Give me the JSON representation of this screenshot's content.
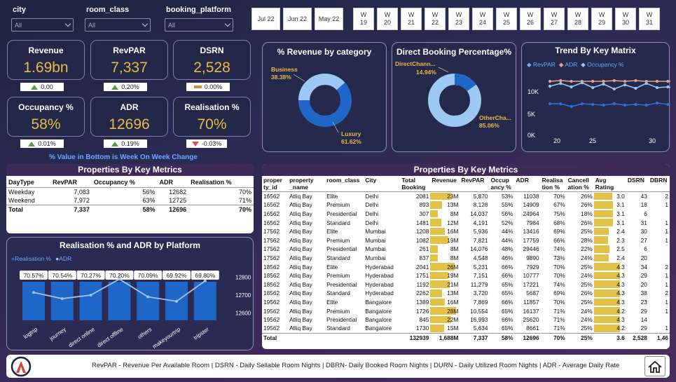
{
  "filters": {
    "city": {
      "label": "city",
      "value": "All"
    },
    "room_class": {
      "label": "room_class",
      "value": "All"
    },
    "booking_platform": {
      "label": "booking_platform",
      "value": "All"
    }
  },
  "months": [
    "Jul 22",
    "Jun 22",
    "May 22"
  ],
  "weeks": [
    "W 19",
    "W 20",
    "W 21",
    "W 22",
    "W 23",
    "W 24",
    "W 25",
    "W 26",
    "W 27",
    "W 28",
    "W 29",
    "W 30",
    "W 31"
  ],
  "kpis": [
    {
      "title": "Revenue",
      "value": "1.69bn",
      "change": "0.00",
      "dir": "up"
    },
    {
      "title": "RevPAR",
      "value": "7,337",
      "change": "0.20%",
      "dir": "up"
    },
    {
      "title": "DSRN",
      "value": "2,528",
      "change": "0.00%",
      "dir": "flat"
    },
    {
      "title": "Occupancy %",
      "value": "58%",
      "change": "0.01%",
      "dir": "up"
    },
    {
      "title": "ADR",
      "value": "12696",
      "change": "0.19%",
      "dir": "up"
    },
    {
      "title": "Realisation %",
      "value": "70%",
      "change": "-0.03%",
      "dir": "down"
    }
  ],
  "wow_note": "% Value in Bottom is Week On Week Change",
  "donut1": {
    "title": "% Revenue by category",
    "a_label": "Business",
    "a_value": "38.38%",
    "b_label": "Luxury",
    "b_value": "61.62%"
  },
  "donut2": {
    "title": "Direct Booking Percentage%",
    "a_label": "DirectChann...",
    "a_value": "14.94%",
    "b_label": "OtherCha...",
    "b_value": "85.06%"
  },
  "trend": {
    "title": "Trend By Key Matrix",
    "legend": [
      "RevPAR",
      "ADR",
      "Occupancy %"
    ],
    "yticks": [
      "10K",
      "5K",
      "0K"
    ],
    "xticks": [
      "20",
      "25",
      "30"
    ],
    "colors": {
      "revpar": "#2f6fd6",
      "adr": "#e8a090",
      "occ": "#9ec5f0"
    }
  },
  "daytype": {
    "title": "Properties By Key Metrics",
    "headers": [
      "DayType",
      "RevPAR",
      "Occupancy %",
      "ADR",
      "Realisation %"
    ],
    "rows": [
      [
        "Weekday",
        "7,083",
        "56%",
        "12682",
        "70%"
      ],
      [
        "Weekend",
        "7,972",
        "63%",
        "12725",
        "71%"
      ]
    ],
    "total": [
      "Total",
      "7,337",
      "58%",
      "12696",
      "70%"
    ]
  },
  "platform": {
    "title": "Realisation % and ADR by Platform",
    "legend": [
      "Realisation %",
      "ADR"
    ],
    "platforms": [
      "logtrip",
      "journey",
      "direct online",
      "direct offline",
      "others",
      "makeyourtrip",
      "tripster"
    ],
    "realisation_labels": [
      "70.57%",
      "70.54%",
      "70.27%",
      "70.20%",
      "70.09%",
      "69.92%",
      "69.80%"
    ],
    "adr_ticks": [
      "12800",
      "12700",
      "12600"
    ],
    "chart_data": {
      "type": "bar",
      "categories": [
        "logtrip",
        "journey",
        "direct online",
        "direct offline",
        "others",
        "makeyourtrip",
        "tripster"
      ],
      "series": [
        {
          "name": "Realisation %",
          "values": [
            70.57,
            70.54,
            70.27,
            70.2,
            70.09,
            69.92,
            69.8
          ]
        },
        {
          "name": "ADR",
          "values": [
            12715,
            12680,
            12700,
            12790,
            12690,
            12665,
            12780
          ]
        }
      ],
      "ylim_adr": [
        12550,
        12850
      ]
    }
  },
  "props": {
    "title": "Properties By Key Metrics",
    "headers": [
      "proper ty_id",
      "property _name",
      "room_class",
      "City",
      "Total Booking",
      "Revenue",
      "RevPAR",
      "Occup ancy %",
      "ADR",
      "Realisa tion %",
      "Cancell ation %",
      "Avg Rating",
      "DSRN",
      "DBRN"
    ],
    "rows": [
      [
        "16562",
        "Atliq Bay",
        "Elite",
        "Delhi",
        "2081",
        "23M",
        "5,870",
        "53%",
        "11038",
        "70%",
        "26%",
        "3.0",
        "43",
        "2"
      ],
      [
        "16562",
        "Atliq Bay",
        "Premium",
        "Delhi",
        "893",
        "13M",
        "8,128",
        "55%",
        "14909",
        "67%",
        "26%",
        "3.1",
        "18",
        "1"
      ],
      [
        "16562",
        "Atliq Bay",
        "Presidential",
        "Delhi",
        "307",
        "8M",
        "14,037",
        "56%",
        "24964",
        "75%",
        "18%",
        "3.1",
        "6",
        ""
      ],
      [
        "16562",
        "Atliq Bay",
        "Standard",
        "Delhi",
        "1481",
        "12M",
        "4,191",
        "52%",
        "7984",
        "68%",
        "26%",
        "3.1",
        "31",
        "1"
      ],
      [
        "17562",
        "Atliq Bay",
        "Elite",
        "Mumbai",
        "1208",
        "16M",
        "5,936",
        "44%",
        "13416",
        "69%",
        "25%",
        "2.4",
        "30",
        "1"
      ],
      [
        "17562",
        "Atliq Bay",
        "Premium",
        "Mumbai",
        "1082",
        "19M",
        "7,821",
        "44%",
        "17759",
        "66%",
        "28%",
        "2.3",
        "27",
        "1"
      ],
      [
        "17562",
        "Atliq Bay",
        "Presidential",
        "Mumbai",
        "261",
        "8M",
        "14,076",
        "48%",
        "29446",
        "74%",
        "22%",
        "2.5",
        "6",
        ""
      ],
      [
        "17562",
        "Atliq Bay",
        "Standard",
        "Mumbai",
        "837",
        "8M",
        "4,548",
        "46%",
        "9890",
        "73%",
        "24%",
        "2.4",
        "20",
        ""
      ],
      [
        "18562",
        "Atliq Bay",
        "Elite",
        "Hyderabad",
        "2041",
        "26M",
        "5,231",
        "66%",
        "7929",
        "70%",
        "25%",
        "4.3",
        "34",
        "2"
      ],
      [
        "18562",
        "Atliq Bay",
        "Premium",
        "Hyderabad",
        "1751",
        "19M",
        "7,151",
        "66%",
        "10777",
        "70%",
        "24%",
        "4.3",
        "29",
        "1"
      ],
      [
        "18562",
        "Atliq Bay",
        "Presidential",
        "Hyderabad",
        "1192",
        "21M",
        "11,279",
        "65%",
        "17221",
        "74%",
        "25%",
        "4.3",
        "20",
        "1"
      ],
      [
        "18562",
        "Atliq Bay",
        "Standard",
        "Hyderabad",
        "2262",
        "13M",
        "3,720",
        "65%",
        "5687",
        "69%",
        "26%",
        "4.3",
        "38",
        "2"
      ],
      [
        "19562",
        "Atliq Bay",
        "Elite",
        "Bangalore",
        "1389",
        "16M",
        "7,869",
        "66%",
        "11857",
        "70%",
        "25%",
        "4.3",
        "23",
        "1"
      ],
      [
        "19562",
        "Atliq Bay",
        "Premium",
        "Bangalore",
        "1726",
        "28M",
        "10,554",
        "65%",
        "16137",
        "71%",
        "24%",
        "4.2",
        "29",
        "1"
      ],
      [
        "19562",
        "Atliq Bay",
        "Presidential",
        "Bangalore",
        "845",
        "22M",
        "16,993",
        "66%",
        "25620",
        "71%",
        "24%",
        "4.3",
        "14",
        ""
      ],
      [
        "19562",
        "Atliq Bay",
        "Standard",
        "Bangalore",
        "1730",
        "15M",
        "5,634",
        "65%",
        "8661",
        "71%",
        "25%",
        "4.2",
        "29",
        "1"
      ]
    ],
    "revenue_fill": [
      0.82,
      0.46,
      0.29,
      0.43,
      0.57,
      0.68,
      0.29,
      0.29,
      0.93,
      0.68,
      0.75,
      0.46,
      0.57,
      1.0,
      0.79,
      0.54
    ],
    "rating_fill": [
      0.65,
      0.67,
      0.67,
      0.67,
      0.52,
      0.5,
      0.54,
      0.52,
      0.93,
      0.93,
      0.93,
      0.93,
      0.93,
      0.91,
      0.93,
      0.91
    ],
    "total": [
      "Total",
      "",
      "",
      "",
      "132939",
      "1,688M",
      "7,337",
      "58%",
      "12696",
      "70%",
      "25%",
      "3.6",
      "2,528",
      "1,46"
    ]
  },
  "footer": {
    "text": "RevPAR - Revenue Per Available Room | DSRN - Daily Sellable Room Nights | DBRN- Daily Booked Room Nights | DURN - Daily Utilized Room Nights | ADR - Average Daily Rate"
  }
}
